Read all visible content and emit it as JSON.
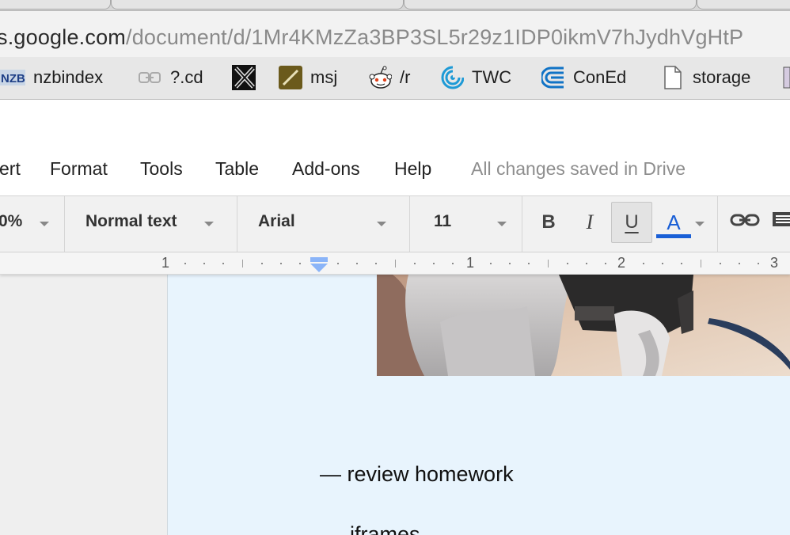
{
  "browser": {
    "url_host": "s.google.com",
    "url_path": "/document/d/1Mr4KMzZa3BP3SL5r29z1IDP0ikmV7hJydhVgHtP",
    "bookmarks": [
      {
        "label": "nzbindex",
        "icon": "nzb-icon"
      },
      {
        "label": "?.cd",
        "icon": "link-icon"
      },
      {
        "label": "",
        "icon": "x-logo-icon"
      },
      {
        "label": "msj",
        "icon": "pen-icon"
      },
      {
        "label": "/r",
        "icon": "reddit-icon"
      },
      {
        "label": "TWC",
        "icon": "twc-swirl-icon"
      },
      {
        "label": "ConEd",
        "icon": "coned-icon"
      },
      {
        "label": "storage",
        "icon": "document-icon"
      }
    ]
  },
  "docs": {
    "menu": [
      "ert",
      "Format",
      "Tools",
      "Table",
      "Add-ons",
      "Help"
    ],
    "save_status": "All changes saved in Drive",
    "toolbar": {
      "zoom": "0%",
      "style": "Normal text",
      "font": "Arial",
      "size": "11",
      "bold": "B",
      "italic": "I",
      "underline": "U",
      "text_color": "A",
      "underline_active": true
    },
    "ruler": {
      "labels": [
        "1",
        "1",
        "2",
        "3"
      ]
    },
    "body": {
      "line1": "— review homework",
      "line2": "iframes"
    }
  },
  "colors": {
    "page_bg": "#e8f4fd",
    "text_color_bar": "#1a5fd6",
    "indent_marker": "#8ab4f8"
  }
}
